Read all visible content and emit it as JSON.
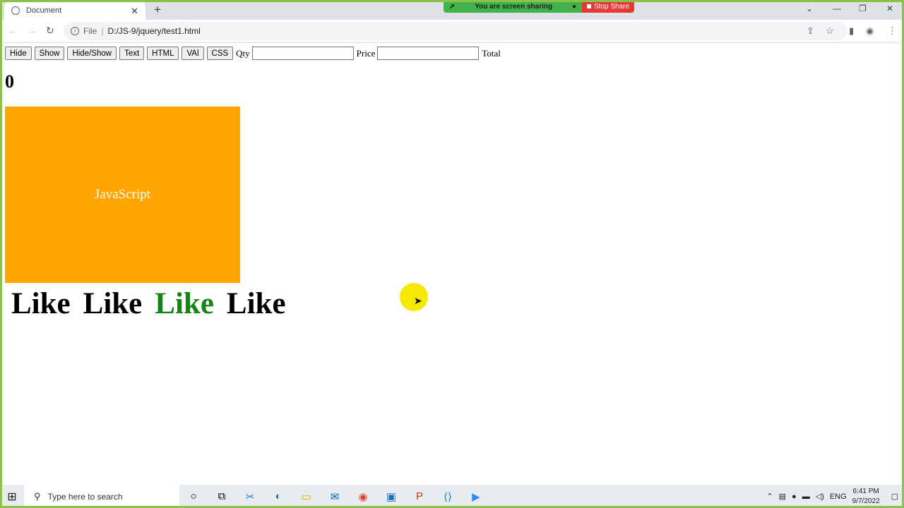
{
  "browser": {
    "tab_title": "Document",
    "url_scheme_label": "File",
    "url": "D:/JS-9/jquery/test1.html"
  },
  "screenshare": {
    "status_text": "You are screen sharing",
    "stop_label": "Stop Share"
  },
  "page": {
    "buttons": [
      "Hide",
      "Show",
      "Hide/Show",
      "Text",
      "HTML",
      "VAl",
      "CSS"
    ],
    "qty_label": "Qty",
    "qty_value": "",
    "price_label": "Price",
    "price_value": "",
    "total_label": "Total",
    "counter": "0",
    "box_text": "JavaScript",
    "box_color": "#ffa500",
    "likes": [
      {
        "text": "Like",
        "color": "black"
      },
      {
        "text": "Like",
        "color": "black"
      },
      {
        "text": "Like",
        "color": "green"
      },
      {
        "text": "Like",
        "color": "black"
      }
    ]
  },
  "taskbar": {
    "search_placeholder": "Type here to search",
    "language": "ENG",
    "time": "6:41 PM",
    "date": "9/7/2022"
  }
}
